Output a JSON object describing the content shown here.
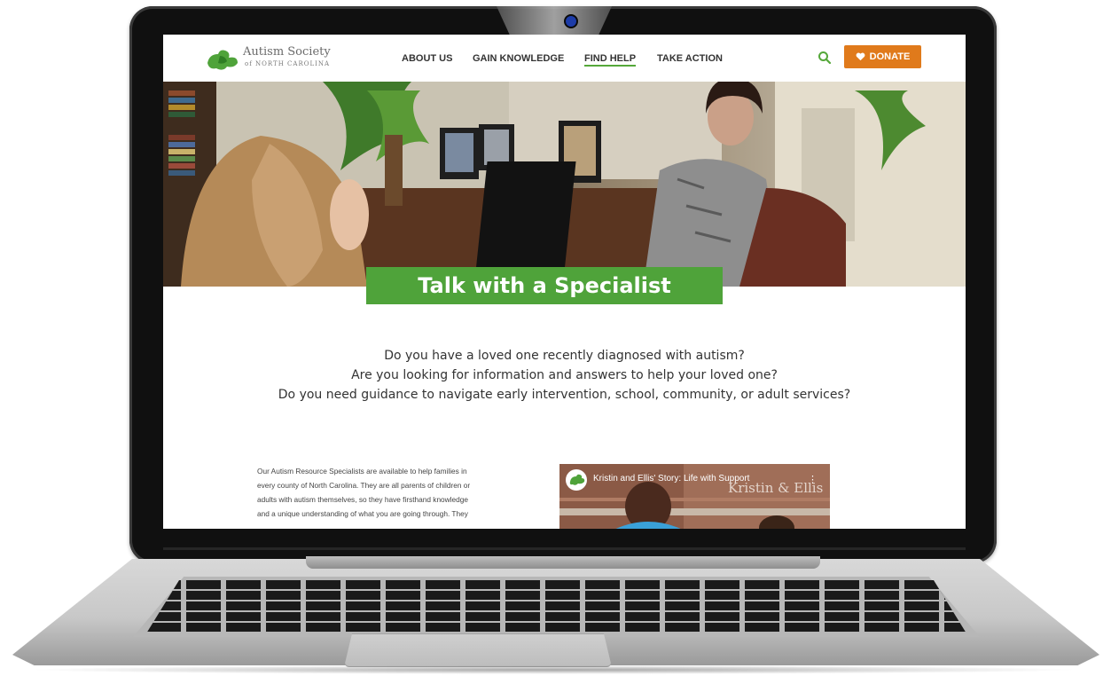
{
  "site": {
    "logo_title": "Autism Society",
    "logo_subtitle": "of NORTH CAROLINA"
  },
  "nav": {
    "items": [
      {
        "label": "ABOUT US"
      },
      {
        "label": "GAIN KNOWLEDGE"
      },
      {
        "label": "FIND HELP",
        "active": true
      },
      {
        "label": "TAKE ACTION"
      }
    ],
    "search_icon": "search-icon",
    "donate_label": "DONATE",
    "donate_icon": "heart-icon"
  },
  "hero": {
    "banner": "Talk with a Specialist"
  },
  "intro": {
    "line1": "Do you have a loved one recently diagnosed with autism?",
    "line2": "Are you looking for information and answers to help your loved one?",
    "line3": "Do you need guidance to navigate early intervention, school, community, or adult services?"
  },
  "body": {
    "line1": "Our Autism Resource Specialists are available to help families in",
    "line2": "every county of North Carolina. They are all parents of children or",
    "line3": "adults with autism themselves, so they have firsthand knowledge",
    "line4": "and a unique understanding of what you are going through. They"
  },
  "video": {
    "title": "Kristin and Ellis' Story: Life with Support",
    "overlay": "Kristin & Ellis",
    "menu": "⋮"
  },
  "colors": {
    "brand_green": "#4fa33a",
    "donate_orange": "#e07a1b",
    "nav_active_underline": "#55a83a"
  }
}
